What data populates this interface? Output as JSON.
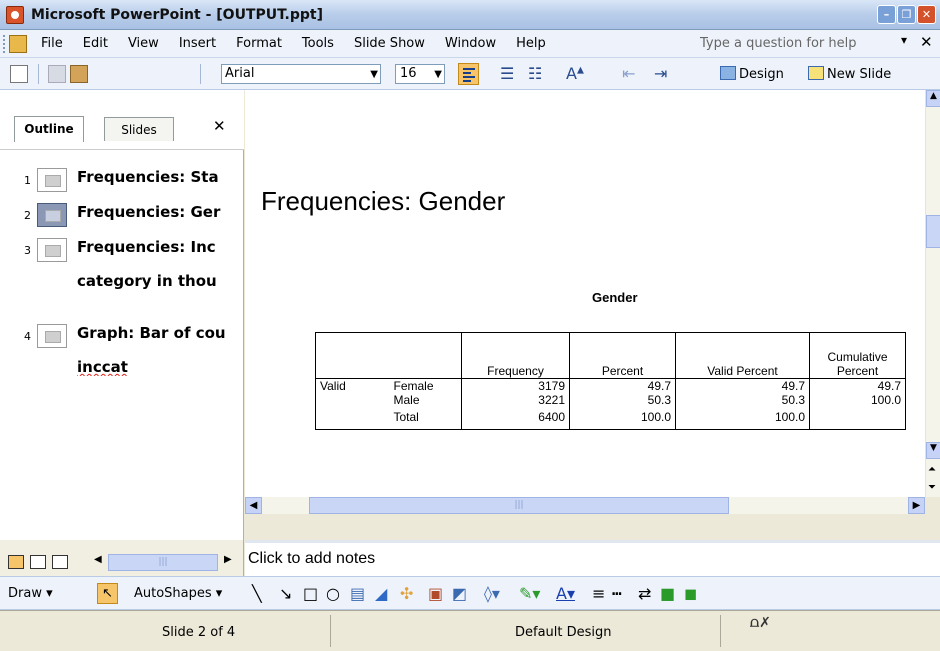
{
  "window": {
    "title": "Microsoft PowerPoint - [OUTPUT.ppt]",
    "controls": [
      "minimize",
      "restore",
      "close"
    ]
  },
  "menubar": {
    "items": [
      "File",
      "Edit",
      "View",
      "Insert",
      "Format",
      "Tools",
      "Slide Show",
      "Window",
      "Help"
    ],
    "help_placeholder": "Type a question for help"
  },
  "toolbar": {
    "font_name": "Arial",
    "font_size": "16",
    "design_label": "Design",
    "new_slide_label": "New Slide"
  },
  "left_panel": {
    "tabs": [
      "Outline",
      "Slides"
    ],
    "active_tab": "Outline",
    "outline": [
      {
        "num": "1",
        "text": "Frequencies: Sta",
        "text2": ""
      },
      {
        "num": "2",
        "text": "Frequencies: Ger",
        "text2": "",
        "selected": true
      },
      {
        "num": "3",
        "text": "Frequencies: Inc",
        "text2": "category in thou"
      },
      {
        "num": "4",
        "text": "Graph: Bar of cou",
        "text2": "inccat"
      }
    ]
  },
  "slide": {
    "title": "Frequencies: Gender",
    "table_caption": "Gender",
    "table": {
      "headers": [
        "Frequency",
        "Percent",
        "Valid Percent",
        "Cumulative Percent"
      ],
      "row_group": "Valid",
      "rows": [
        {
          "label": "Female",
          "values": [
            "3179",
            "49.7",
            "49.7",
            "49.7"
          ]
        },
        {
          "label": "Male",
          "values": [
            "3221",
            "50.3",
            "50.3",
            "100.0"
          ]
        },
        {
          "label": "Total",
          "values": [
            "6400",
            "100.0",
            "100.0",
            ""
          ]
        }
      ]
    }
  },
  "notes": {
    "placeholder": "Click to add notes"
  },
  "drawbar": {
    "draw_label": "Draw",
    "autoshapes_label": "AutoShapes"
  },
  "statusbar": {
    "slide_info": "Slide 2 of 4",
    "design_name": "Default Design"
  }
}
